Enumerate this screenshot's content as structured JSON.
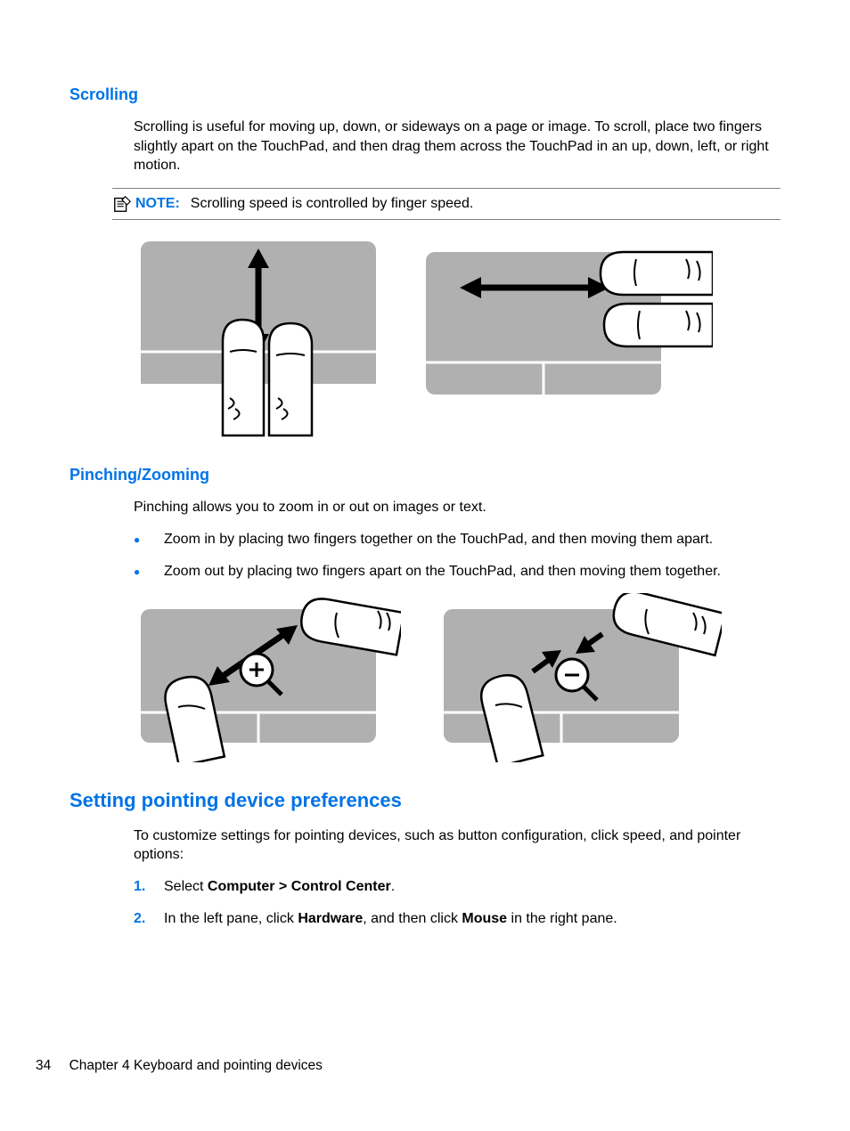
{
  "scrolling": {
    "heading": "Scrolling",
    "para": "Scrolling is useful for moving up, down, or sideways on a page or image. To scroll, place two fingers slightly apart on the TouchPad, and then drag them across the TouchPad in an up, down, left, or right motion.",
    "note_label": "NOTE:",
    "note_text": "Scrolling speed is controlled by finger speed."
  },
  "pinching": {
    "heading": "Pinching/Zooming",
    "para": "Pinching allows you to zoom in or out on images or text.",
    "bullets": [
      "Zoom in by placing two fingers together on the TouchPad, and then moving them apart.",
      "Zoom out by placing two fingers apart on the TouchPad, and then moving them together."
    ]
  },
  "setting": {
    "heading": "Setting pointing device preferences",
    "para": "To customize settings for pointing devices, such as button configuration, click speed, and pointer options:",
    "step1_prefix": "Select ",
    "step1_bold": "Computer > Control Center",
    "step1_suffix": ".",
    "step2_a": "In the left pane, click ",
    "step2_b": "Hardware",
    "step2_c": ", and then click ",
    "step2_d": "Mouse",
    "step2_e": " in the right pane."
  },
  "footer": {
    "page": "34",
    "chapter": "Chapter 4   Keyboard and pointing devices"
  }
}
